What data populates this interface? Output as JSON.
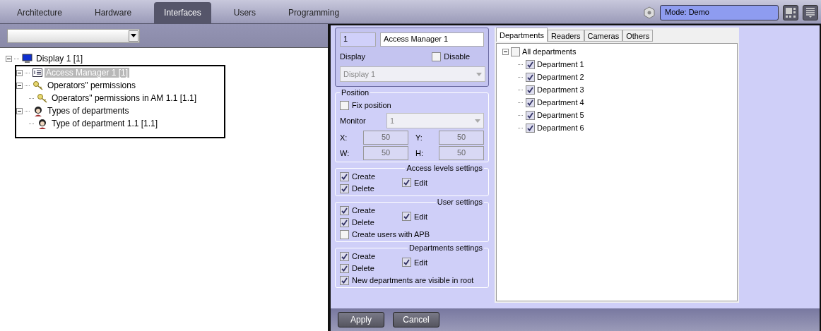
{
  "top_tabs": [
    {
      "label": "Architecture",
      "selected": false
    },
    {
      "label": "Hardware",
      "selected": false
    },
    {
      "label": "Interfaces",
      "selected": true
    },
    {
      "label": "Users",
      "selected": false
    },
    {
      "label": "Programming",
      "selected": false
    }
  ],
  "mode_field": {
    "value": "Mode: Demo"
  },
  "object_tree": [
    {
      "label": "Display 1 [1]",
      "kind": "monitor",
      "selected": false,
      "expanded": true,
      "children": [
        {
          "label": "Access Manager 1 [1]",
          "kind": "list",
          "selected": true,
          "expanded": true,
          "children": [
            {
              "label": "Operators\" permissions",
              "kind": "key",
              "selected": false,
              "expanded": true,
              "children": [
                {
                  "label": "Operators\" permissions in AM 1.1 [1.1]",
                  "kind": "key",
                  "selected": false
                }
              ]
            },
            {
              "label": "Types of departments",
              "kind": "figure",
              "selected": false,
              "expanded": true,
              "children": [
                {
                  "label": "Type of department 1.1 [1.1]",
                  "kind": "figure",
                  "selected": false
                }
              ]
            }
          ]
        }
      ]
    }
  ],
  "settings": {
    "id": "1",
    "name": "Access Manager 1",
    "display_label": "Display",
    "disable": {
      "label": "Disable",
      "checked": false
    },
    "display_select": {
      "value": "Display 1",
      "disabled": true
    }
  },
  "position": {
    "title": "Position",
    "fix_position": {
      "label": "Fix position",
      "checked": false
    },
    "monitor_label": "Monitor",
    "monitor_select": {
      "value": "1",
      "disabled": true
    },
    "coords": [
      {
        "label": "X:",
        "value": "50"
      },
      {
        "label": "Y:",
        "value": "50"
      },
      {
        "label": "W:",
        "value": "50"
      },
      {
        "label": "H:",
        "value": "50"
      }
    ]
  },
  "groups": [
    {
      "title": "Access levels settings",
      "items": [
        {
          "label": "Create",
          "checked": true,
          "kind": "stack"
        },
        {
          "label": "Delete",
          "checked": true,
          "kind": "stack"
        },
        {
          "label": "Edit",
          "checked": true,
          "kind": "side"
        }
      ]
    },
    {
      "title": "User settings",
      "items": [
        {
          "label": "Create",
          "checked": true,
          "kind": "stack"
        },
        {
          "label": "Delete",
          "checked": true,
          "kind": "stack"
        },
        {
          "label": "Edit",
          "checked": true,
          "kind": "side"
        },
        {
          "label": "Create users with APB",
          "checked": false,
          "kind": "wide"
        }
      ]
    },
    {
      "title": "Departments settings",
      "items": [
        {
          "label": "Create",
          "checked": true,
          "kind": "stack"
        },
        {
          "label": "Delete",
          "checked": true,
          "kind": "stack"
        },
        {
          "label": "Edit",
          "checked": true,
          "kind": "side"
        },
        {
          "label": "New departments are visible in root",
          "checked": true,
          "kind": "wide"
        }
      ]
    }
  ],
  "filter_tabs": [
    {
      "label": "Departments",
      "selected": true
    },
    {
      "label": "Readers",
      "selected": false
    },
    {
      "label": "Cameras",
      "selected": false
    },
    {
      "label": "Others",
      "selected": false
    }
  ],
  "department_tree": [
    {
      "label": "All departments",
      "checked": false,
      "expanded": true,
      "children": [
        {
          "label": "Department 1",
          "checked": true
        },
        {
          "label": "Department 2",
          "checked": true
        },
        {
          "label": "Department 3",
          "checked": true
        },
        {
          "label": "Department 4",
          "checked": true
        },
        {
          "label": "Department 5",
          "checked": true
        },
        {
          "label": "Department 6",
          "checked": true
        }
      ]
    }
  ],
  "buttons": [
    {
      "label": "Apply"
    },
    {
      "label": "Cancel"
    }
  ]
}
